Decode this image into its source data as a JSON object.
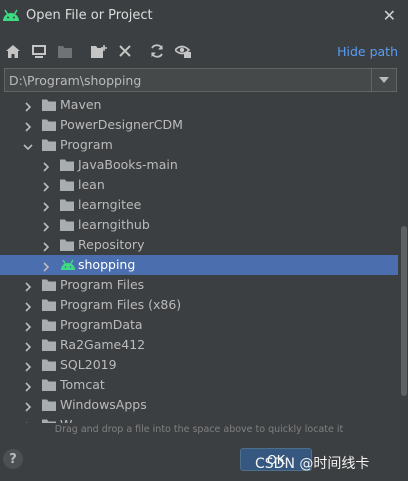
{
  "window": {
    "title": "Open File or Project",
    "close_icon": "close-icon",
    "accent": "#589df6"
  },
  "toolbar": {
    "icons": [
      "home-icon",
      "desktop-icon",
      "project-folder-icon",
      "new-folder-icon",
      "delete-icon",
      "refresh-icon",
      "show-hidden-icon"
    ],
    "hide_path_label": "Hide path"
  },
  "path": {
    "value": "D:\\Program\\shopping"
  },
  "tree": {
    "rows": [
      {
        "label": "Maven",
        "expanded": false,
        "selected": false
      },
      {
        "label": "PowerDesignerCDM",
        "expanded": false,
        "selected": false
      },
      {
        "label": "Program",
        "expanded": true,
        "selected": false
      },
      {
        "label": "JavaBooks-main",
        "expanded": false,
        "selected": false
      },
      {
        "label": "lean",
        "expanded": false,
        "selected": false
      },
      {
        "label": "learngitee",
        "expanded": false,
        "selected": false
      },
      {
        "label": "learngithub",
        "expanded": false,
        "selected": false
      },
      {
        "label": "Repository",
        "expanded": false,
        "selected": false
      },
      {
        "label": "shopping",
        "expanded": false,
        "selected": true,
        "icon": "android-icon"
      },
      {
        "label": "Program Files",
        "expanded": false,
        "selected": false
      },
      {
        "label": "Program Files (x86)",
        "expanded": false,
        "selected": false
      },
      {
        "label": "ProgramData",
        "expanded": false,
        "selected": false
      },
      {
        "label": "Ra2Game412",
        "expanded": false,
        "selected": false
      },
      {
        "label": "SQL2019",
        "expanded": false,
        "selected": false
      },
      {
        "label": "Tomcat",
        "expanded": false,
        "selected": false
      },
      {
        "label": "WindowsApps",
        "expanded": false,
        "selected": false
      },
      {
        "label": "W...",
        "expanded": false,
        "selected": false
      }
    ]
  },
  "footer": {
    "hint": "Drag and drop a file into the space above to quickly locate it",
    "help_label": "?",
    "ok_label": "OK",
    "watermark": "CSDN @时间线卡"
  },
  "colors": {
    "selection": "#4b6eaf",
    "background": "#3c3f41",
    "android": "#3ddc84",
    "folder": "#a8adb0"
  }
}
